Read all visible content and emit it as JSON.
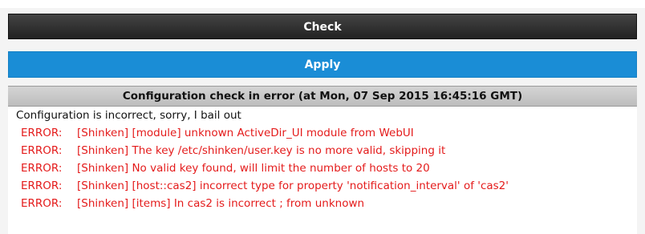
{
  "buttons": {
    "check_label": "Check",
    "apply_label": "Apply"
  },
  "result": {
    "header": "Configuration check in error (at Mon, 07 Sep 2015 16:45:16 GMT)",
    "summary": "Configuration is incorrect, sorry, I bail out",
    "errors": [
      {
        "level": "ERROR:",
        "message": "[Shinken] [module] unknown ActiveDir_UI module from WebUI"
      },
      {
        "level": "ERROR:",
        "message": "[Shinken] The key /etc/shinken/user.key is no more valid, skipping it"
      },
      {
        "level": "ERROR:",
        "message": "[Shinken] No valid key found, will limit the number of hosts to 20"
      },
      {
        "level": "ERROR:",
        "message": "[Shinken] [host::cas2] incorrect type for property 'notification_interval' of 'cas2'"
      },
      {
        "level": "ERROR:",
        "message": "[Shinken] [items] In cas2 is incorrect ; from unknown"
      }
    ]
  },
  "colors": {
    "check_button_bg": "#2b2b2b",
    "apply_button_bg": "#1a8dd6",
    "error_text": "#e41b1b"
  }
}
